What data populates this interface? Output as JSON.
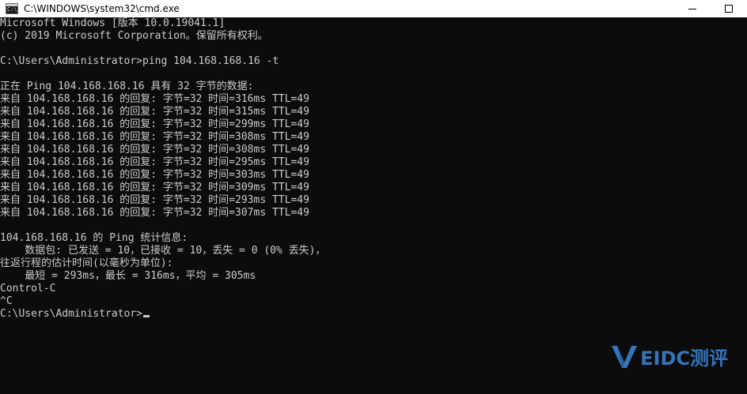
{
  "window": {
    "title": "C:\\WINDOWS\\system32\\cmd.exe",
    "icon": "cmd-icon",
    "icon_glyph": "C:\\"
  },
  "controls": {
    "minimize_icon": "minimize-icon",
    "maximize_icon": "maximize-icon"
  },
  "terminal": {
    "lines": [
      "Microsoft Windows [版本 10.0.19041.1]",
      "(c) 2019 Microsoft Corporation。保留所有权利。",
      "",
      "C:\\Users\\Administrator>ping 104.168.168.16 -t",
      "",
      "正在 Ping 104.168.168.16 具有 32 字节的数据:",
      "来自 104.168.168.16 的回复: 字节=32 时间=316ms TTL=49",
      "来自 104.168.168.16 的回复: 字节=32 时间=315ms TTL=49",
      "来自 104.168.168.16 的回复: 字节=32 时间=299ms TTL=49",
      "来自 104.168.168.16 的回复: 字节=32 时间=308ms TTL=49",
      "来自 104.168.168.16 的回复: 字节=32 时间=308ms TTL=49",
      "来自 104.168.168.16 的回复: 字节=32 时间=295ms TTL=49",
      "来自 104.168.168.16 的回复: 字节=32 时间=303ms TTL=49",
      "来自 104.168.168.16 的回复: 字节=32 时间=309ms TTL=49",
      "来自 104.168.168.16 的回复: 字节=32 时间=293ms TTL=49",
      "来自 104.168.168.16 的回复: 字节=32 时间=307ms TTL=49",
      "",
      "104.168.168.16 的 Ping 统计信息:",
      "    数据包: 已发送 = 10，已接收 = 10，丢失 = 0 (0% 丢失)，",
      "往返行程的估计时间(以毫秒为单位):",
      "    最短 = 293ms，最长 = 316ms，平均 = 305ms",
      "Control-C",
      "^C",
      "C:\\Users\\Administrator>"
    ]
  },
  "watermark": {
    "logo_icon": "veidc-v-logo-icon",
    "text": "EIDC测评",
    "color": "#3f86d8"
  },
  "colors": {
    "background": "#0c0c0c",
    "foreground": "#cccccc",
    "titlebar": "#ffffff"
  }
}
